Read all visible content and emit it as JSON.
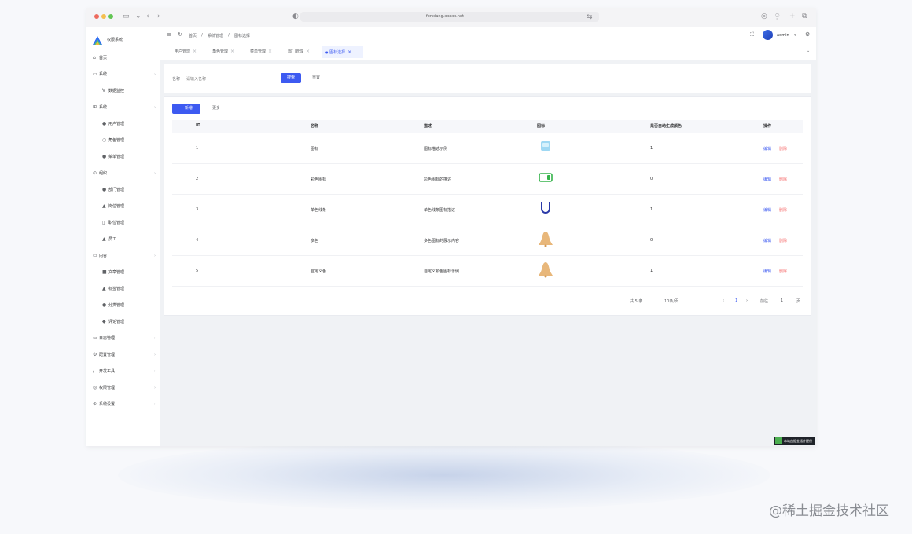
{
  "browser": {
    "url": "fenxiang.xxxxx.net"
  },
  "sidebar": {
    "title": "权限系统",
    "items": [
      {
        "icon": "home-icon",
        "glyph": "⌂",
        "label": "首页",
        "child": false,
        "arrow": false
      },
      {
        "icon": "monitor-icon",
        "glyph": "▭",
        "label": "系统",
        "child": false,
        "arrow": true
      },
      {
        "icon": "filter-icon",
        "glyph": "∀",
        "label": "数据监控",
        "child": true,
        "arrow": false
      },
      {
        "icon": "grid-icon",
        "glyph": "⊞",
        "label": "系统",
        "child": false,
        "arrow": true
      },
      {
        "icon": "user-icon",
        "glyph": "●",
        "label": "用户管理",
        "child": true,
        "arrow": false
      },
      {
        "icon": "role-icon",
        "glyph": "○",
        "label": "角色管理",
        "child": true,
        "arrow": false
      },
      {
        "icon": "menu-icon",
        "glyph": "●",
        "label": "菜单管理",
        "child": true,
        "arrow": false
      },
      {
        "icon": "org-icon",
        "glyph": "⊙",
        "label": "组织",
        "child": false,
        "arrow": true
      },
      {
        "icon": "dept-icon",
        "glyph": "●",
        "label": "部门管理",
        "child": true,
        "arrow": false
      },
      {
        "icon": "person-icon",
        "glyph": "▲",
        "label": "岗位管理",
        "child": true,
        "arrow": false
      },
      {
        "icon": "doc-icon",
        "glyph": "▯",
        "label": "职位管理",
        "child": true,
        "arrow": false
      },
      {
        "icon": "staff-icon",
        "glyph": "▲",
        "label": "员工",
        "child": true,
        "arrow": false
      },
      {
        "icon": "folder-icon",
        "glyph": "▭",
        "label": "内容",
        "child": false,
        "arrow": true
      },
      {
        "icon": "article-icon",
        "glyph": "■",
        "label": "文章管理",
        "child": true,
        "arrow": false
      },
      {
        "icon": "tag-icon",
        "glyph": "▲",
        "label": "标签管理",
        "child": true,
        "arrow": false
      },
      {
        "icon": "category-icon",
        "glyph": "●",
        "label": "分类管理",
        "child": true,
        "arrow": false
      },
      {
        "icon": "comment-icon",
        "glyph": "◆",
        "label": "评论管理",
        "child": true,
        "arrow": false
      },
      {
        "icon": "log-icon",
        "glyph": "▭",
        "label": "日志管理",
        "child": false,
        "arrow": true
      },
      {
        "icon": "settings-icon",
        "glyph": "⚙",
        "label": "配置管理",
        "child": false,
        "arrow": true
      },
      {
        "icon": "tool-icon",
        "glyph": "∕",
        "label": "开发工具",
        "child": false,
        "arrow": true
      },
      {
        "icon": "lock-icon",
        "glyph": "◎",
        "label": "权限管理",
        "child": false,
        "arrow": true
      },
      {
        "icon": "system-icon",
        "glyph": "⊕",
        "label": "系统设置",
        "child": false,
        "arrow": true
      }
    ]
  },
  "header": {
    "breadcrumbs": [
      "首页",
      "系统管理",
      "图标选择"
    ],
    "user": "admin"
  },
  "tabs": [
    {
      "label": "用户管理",
      "active": false
    },
    {
      "label": "角色管理",
      "active": false
    },
    {
      "label": "菜单管理",
      "active": false
    },
    {
      "label": "部门管理",
      "active": false
    },
    {
      "label": "图标选择",
      "active": true
    }
  ],
  "search": {
    "label": "名称",
    "placeholder": "请输入名称",
    "search_button": "搜索",
    "reset_button": "重置"
  },
  "toolbar": {
    "add_button": "+ 新增",
    "more_button": "更多"
  },
  "table": {
    "columns": [
      "ID",
      "名称",
      "描述",
      "图标",
      "是否自动生成颜色",
      "操作"
    ],
    "rows": [
      {
        "id": "1",
        "name": "图标",
        "desc": "图标描述示例",
        "icon": "cube-icon",
        "auto": "1"
      },
      {
        "id": "2",
        "name": "彩色图标",
        "desc": "彩色图标的描述",
        "icon": "card-icon",
        "auto": "0"
      },
      {
        "id": "3",
        "name": "单色线条",
        "desc": "单色线条图标描述",
        "icon": "magnet-icon",
        "auto": "1"
      },
      {
        "id": "4",
        "name": "多色",
        "desc": "多色图标的展示内容",
        "icon": "bell-icon",
        "auto": "0"
      },
      {
        "id": "5",
        "name": "自定义色",
        "desc": "自定义颜色图标示例",
        "icon": "bell-icon",
        "auto": "1"
      }
    ],
    "edit_label": "编辑",
    "delete_label": "删除"
  },
  "pagination": {
    "total": "共 5 条",
    "page_size": "10条/页",
    "prev": "‹",
    "current": "1",
    "next": "›",
    "goto_label": "前往",
    "goto_value": "1",
    "goto_suffix": "页"
  },
  "corner_badge": "本站由掘金插件提供",
  "watermark": "@稀土掘金技术社区",
  "colors": {
    "primary": "#3d5af1",
    "danger": "#f56c6c",
    "background": "#f0f2f5"
  }
}
